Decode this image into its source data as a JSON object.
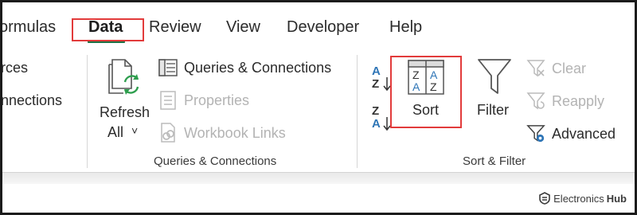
{
  "tabs": [
    {
      "label": "ormulas",
      "active": false
    },
    {
      "label": "Data",
      "active": true
    },
    {
      "label": "Review",
      "active": false
    },
    {
      "label": "View",
      "active": false
    },
    {
      "label": "Developer",
      "active": false
    },
    {
      "label": "Help",
      "active": false
    }
  ],
  "left_cut": {
    "line1": "rces",
    "line2": "nnections"
  },
  "queries_group": {
    "refresh_line1": "Refresh",
    "refresh_line2": "All",
    "refresh_chevron": "˅",
    "queries_connections": "Queries & Connections",
    "properties": "Properties",
    "workbook_links": "Workbook Links",
    "group_label": "Queries & Connections"
  },
  "sort_group": {
    "sort_az_top": "A",
    "sort_az_bottom": "Z",
    "sort_za_top": "Z",
    "sort_za_bottom": "A",
    "sort_label": "Sort",
    "filter_label": "Filter",
    "clear": "Clear",
    "reapply": "Reapply",
    "advanced": "Advanced",
    "group_label": "Sort & Filter"
  },
  "watermark": {
    "brand": "Electronics",
    "hub": "Hub"
  },
  "colors": {
    "accent_green": "#1e7145",
    "highlight_red": "#e23b3b",
    "sort_blue": "#2e75b6",
    "refresh_green": "#2e9e4e",
    "disabled_gray": "#b3b3b3"
  }
}
